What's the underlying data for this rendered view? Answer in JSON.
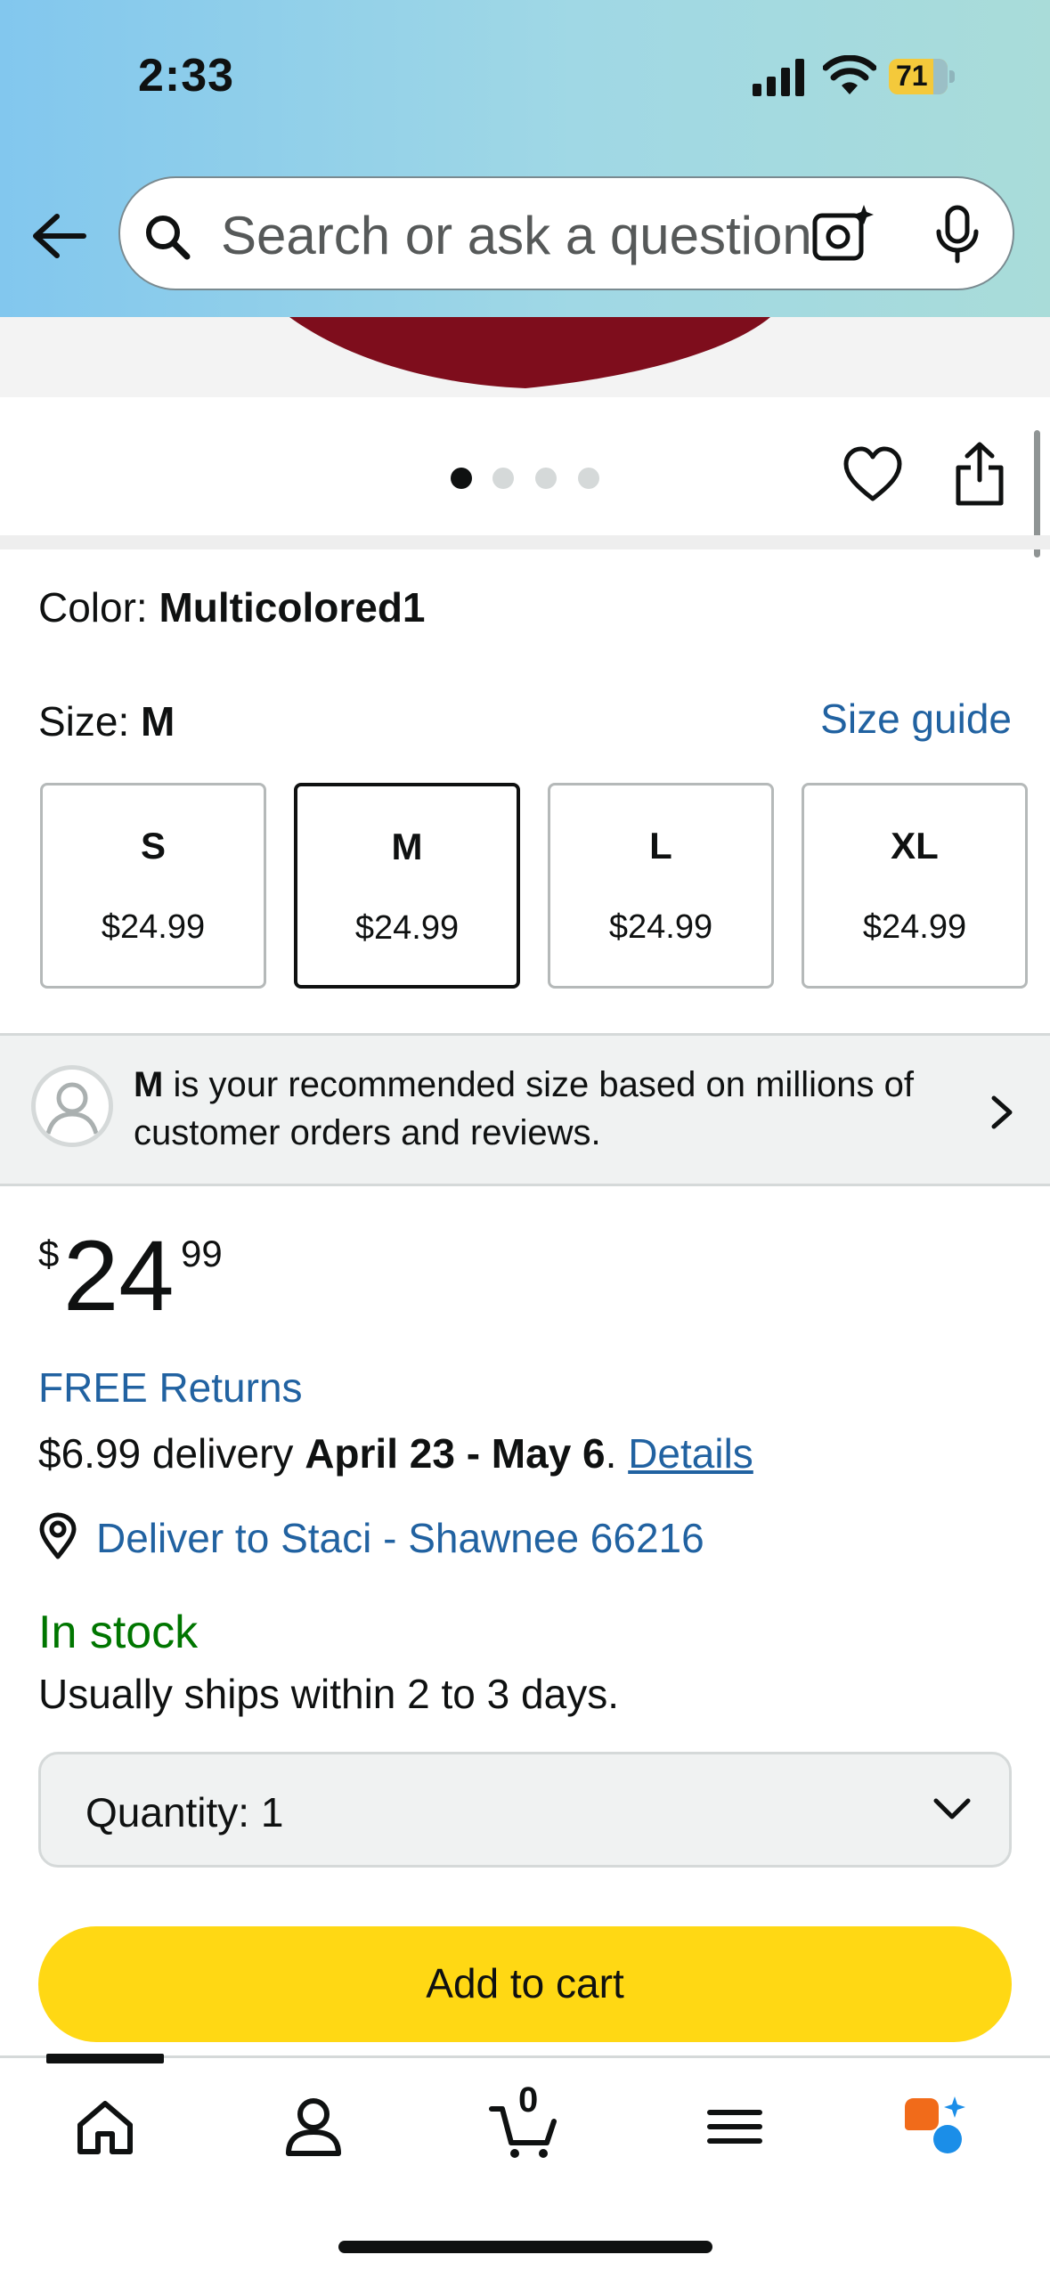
{
  "status_bar": {
    "time": "2:33",
    "battery": "71"
  },
  "search": {
    "placeholder": "Search or ask a question"
  },
  "gallery": {
    "dots": 4,
    "active_dot": 1
  },
  "color": {
    "label": "Color: ",
    "value": "Multicolored1"
  },
  "size": {
    "label": "Size: ",
    "value": "M",
    "guide_label": "Size guide",
    "options": [
      {
        "label": "S",
        "price": "$24.99"
      },
      {
        "label": "M",
        "price": "$24.99"
      },
      {
        "label": "L",
        "price": "$24.99"
      },
      {
        "label": "XL",
        "price": "$24.99"
      }
    ]
  },
  "recommendation": {
    "size": "M",
    "text": " is your recommended size based on millions of customer orders and reviews."
  },
  "price": {
    "symbol": "$",
    "whole": "24",
    "fraction": "99"
  },
  "shipping": {
    "free_returns": "FREE Returns",
    "delivery_prefix": "$6.99 delivery ",
    "delivery_dates": "April 23 - May 6",
    "delivery_suffix": ". ",
    "details_link": "Details",
    "deliver_to": "Deliver to Staci - Shawnee 66216"
  },
  "stock": {
    "status": "In stock",
    "ships": "Usually ships within 2 to 3 days."
  },
  "quantity": {
    "label": "Quantity: ",
    "value": "1"
  },
  "add_to_cart": "Add to cart",
  "nav": {
    "items": [
      "home-icon",
      "account-icon",
      "cart-icon",
      "menu-icon",
      "rufus-icon"
    ],
    "cart_count": "0"
  },
  "colors": {
    "accent_link": "#2162a1",
    "in_stock": "#007600",
    "cart_button": "#ffd814"
  }
}
